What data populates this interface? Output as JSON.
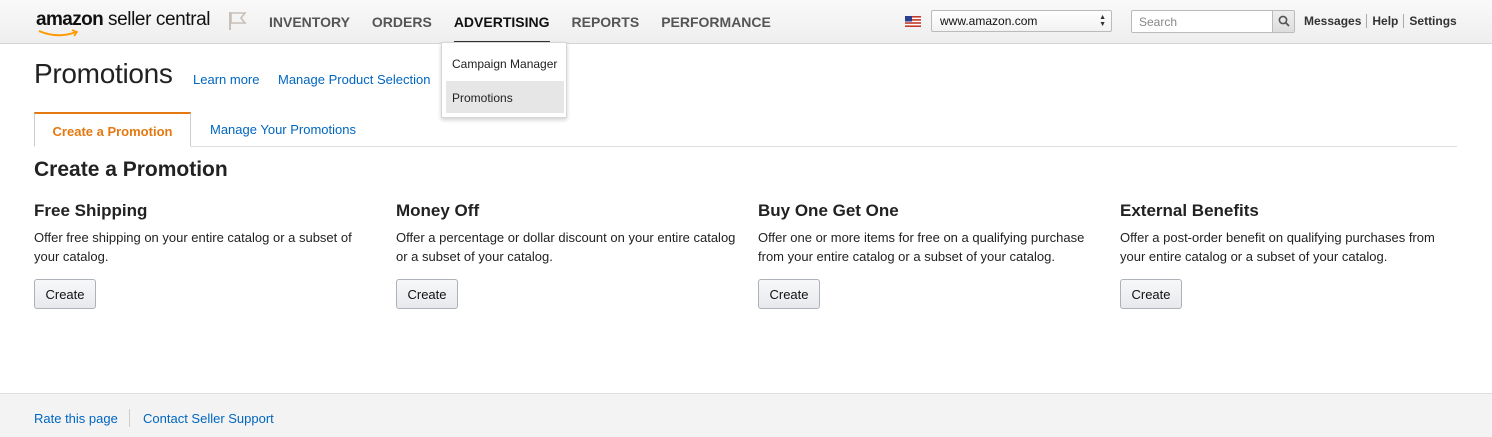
{
  "header": {
    "logo_bold": "amazon",
    "logo_light": " seller central",
    "nav": [
      "INVENTORY",
      "ORDERS",
      "ADVERTISING",
      "REPORTS",
      "PERFORMANCE"
    ],
    "active_nav": "ADVERTISING",
    "marketplace_value": "www.amazon.com",
    "search_placeholder": "Search",
    "links": [
      "Messages",
      "Help",
      "Settings"
    ]
  },
  "dropdown": {
    "items": [
      "Campaign Manager",
      "Promotions"
    ],
    "highlighted": "Promotions"
  },
  "page": {
    "title": "Promotions",
    "learn_more": "Learn more",
    "manage_product_selection": "Manage Product Selection"
  },
  "tabs": [
    {
      "label": "Create a Promotion",
      "active": true
    },
    {
      "label": "Manage Your Promotions",
      "active": false
    }
  ],
  "section_heading": "Create a Promotion",
  "cards": [
    {
      "title": "Free Shipping",
      "description": "Offer free shipping on your entire catalog or a subset of your catalog.",
      "button": "Create"
    },
    {
      "title": "Money Off",
      "description": "Offer a percentage or dollar discount on your entire catalog or a subset of your catalog.",
      "button": "Create"
    },
    {
      "title": "Buy One Get One",
      "description": "Offer one or more items for free on a qualifying purchase from your entire catalog or a subset of your catalog.",
      "button": "Create"
    },
    {
      "title": "External Benefits",
      "description": "Offer a post-order benefit on qualifying purchases from your entire catalog or a subset of your catalog.",
      "button": "Create"
    }
  ],
  "footer": {
    "links": [
      "Rate this page",
      "Contact Seller Support"
    ]
  },
  "colors": {
    "link": "#0066c0",
    "active_tab": "#e47911",
    "logo_smile": "#ff9900"
  }
}
